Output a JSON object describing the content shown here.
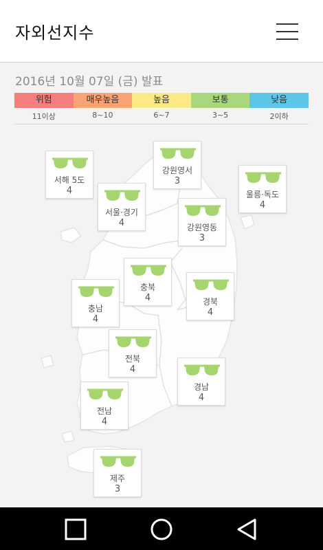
{
  "header": {
    "title": "자외선지수",
    "menu_icon": "hamburger-menu-icon"
  },
  "date_label": "2016년 10월 07일 (금) 발표",
  "legend": [
    {
      "label": "위험",
      "range": "11이상",
      "color": "#f47f7c"
    },
    {
      "label": "매우높음",
      "range": "8~10",
      "color": "#f9a472"
    },
    {
      "label": "높음",
      "range": "6~7",
      "color": "#fbe886"
    },
    {
      "label": "보통",
      "range": "3~5",
      "color": "#a9d77b"
    },
    {
      "label": "낮음",
      "range": "2이하",
      "color": "#5cc5e8"
    }
  ],
  "regions": [
    {
      "name": "서해 5도",
      "value": "4",
      "icon": "sunglasses-icon"
    },
    {
      "name": "강원영서",
      "value": "3",
      "icon": "sunglasses-icon"
    },
    {
      "name": "울릉·독도",
      "value": "4",
      "icon": "sunglasses-icon"
    },
    {
      "name": "서울·경기",
      "value": "4",
      "icon": "sunglasses-icon"
    },
    {
      "name": "강원영동",
      "value": "3",
      "icon": "sunglasses-icon"
    },
    {
      "name": "충북",
      "value": "4",
      "icon": "sunglasses-icon"
    },
    {
      "name": "충남",
      "value": "4",
      "icon": "sunglasses-icon"
    },
    {
      "name": "경북",
      "value": "4",
      "icon": "sunglasses-icon"
    },
    {
      "name": "전북",
      "value": "4",
      "icon": "sunglasses-icon"
    },
    {
      "name": "경남",
      "value": "4",
      "icon": "sunglasses-icon"
    },
    {
      "name": "전남",
      "value": "4",
      "icon": "sunglasses-icon"
    },
    {
      "name": "제주",
      "value": "3",
      "icon": "sunglasses-icon"
    }
  ],
  "icon_color": "#a6d56f",
  "navbar": {
    "icons": [
      "recent-apps-icon",
      "home-icon",
      "back-icon"
    ]
  }
}
